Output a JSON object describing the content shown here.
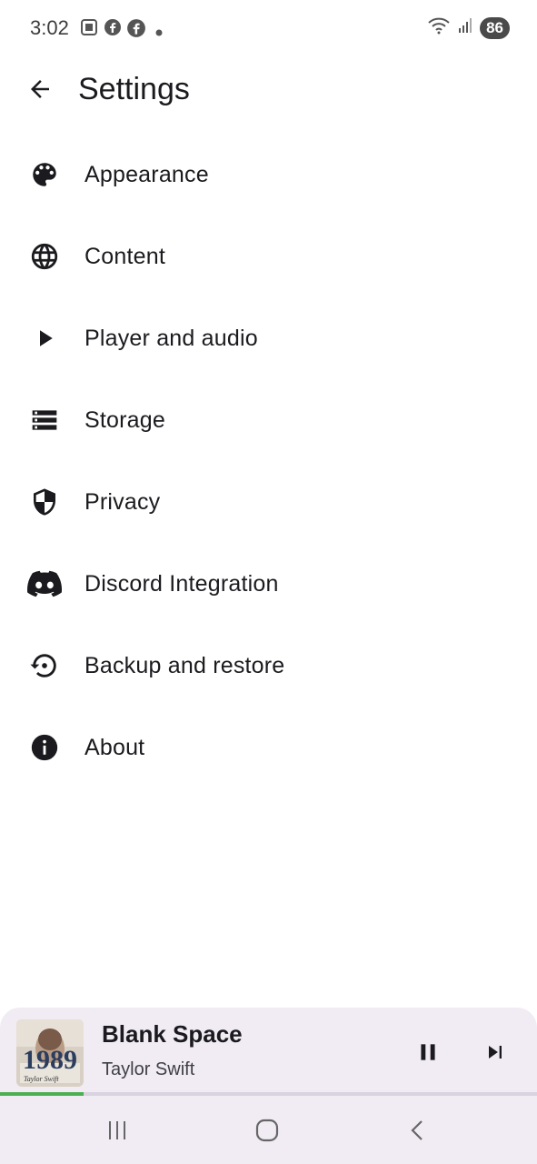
{
  "status_bar": {
    "time": "3:02",
    "battery": "86"
  },
  "app_bar": {
    "title": "Settings"
  },
  "settings": [
    {
      "label": "Appearance",
      "icon": "palette-icon"
    },
    {
      "label": "Content",
      "icon": "globe-icon"
    },
    {
      "label": "Player and audio",
      "icon": "play-icon"
    },
    {
      "label": "Storage",
      "icon": "storage-icon"
    },
    {
      "label": "Privacy",
      "icon": "shield-icon"
    },
    {
      "label": "Discord Integration",
      "icon": "discord-icon"
    },
    {
      "label": "Backup and restore",
      "icon": "restore-icon"
    },
    {
      "label": "About",
      "icon": "info-icon"
    }
  ],
  "player": {
    "title": "Blank Space",
    "artist": "Taylor Swift",
    "album_text": "1989",
    "album_caption": "Taylor Swift",
    "progress_fraction": 0.155
  },
  "colors": {
    "accent": "#4caf50",
    "player_bg": "#f1ecf4",
    "text": "#1b1b1f"
  }
}
